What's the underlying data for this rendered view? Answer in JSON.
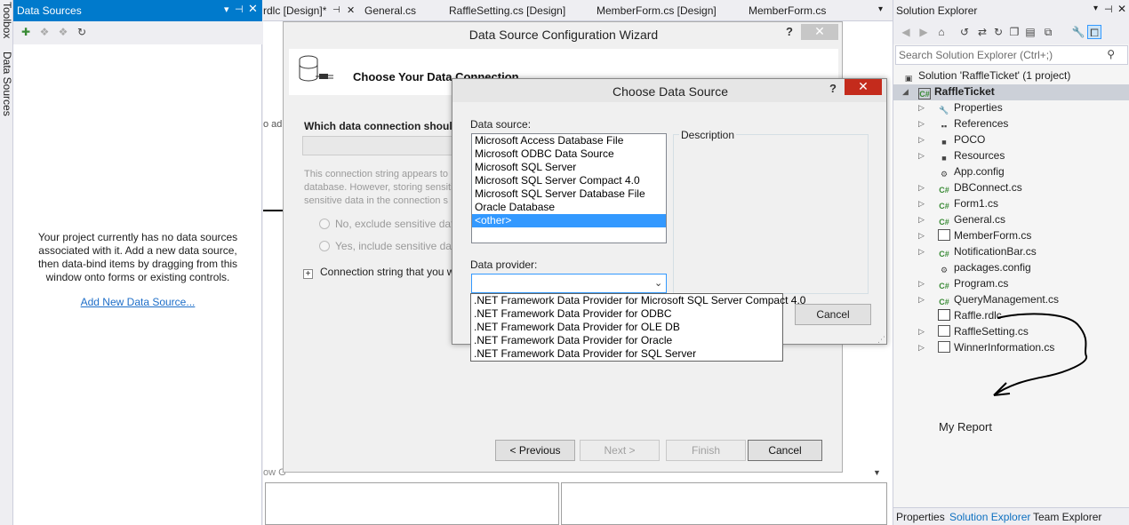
{
  "toolbox_strip": {
    "toolbox_label": "Toolbox",
    "data_sources_label": "Data Sources"
  },
  "data_sources": {
    "title": "Data Sources",
    "message": "Your project currently has no data sources associated with it. Add a new data source, then data-bind items by dragging from this window onto forms or existing controls.",
    "add_link": "Add New Data Source..."
  },
  "tabs": [
    "rdlc [Design]*",
    "General.cs",
    "RaffleSetting.cs [Design]",
    "MemberForm.cs [Design]",
    "MemberForm.cs"
  ],
  "editor": {
    "hint": "o ad",
    "group_label": "ow G"
  },
  "wizard": {
    "title": "Data Source Configuration Wizard",
    "help": "?",
    "heading": "Choose Your Data Connection",
    "question": "Which data connection should y",
    "info_lines": [
      "This connection string appears to",
      "database. However, storing sensiti",
      "sensitive data in the connection s"
    ],
    "radio_no": "No, exclude sensitive data",
    "radio_yes": "Yes, include sensitive da",
    "expand_label": "Connection string that you w",
    "buttons": {
      "previous": "< Previous",
      "next": "Next >",
      "finish": "Finish",
      "cancel": "Cancel"
    }
  },
  "choose_data_source": {
    "title": "Choose Data Source",
    "help": "?",
    "data_source_label": "Data source:",
    "data_sources": [
      "Microsoft Access Database File",
      "Microsoft ODBC Data Source",
      "Microsoft SQL Server",
      "Microsoft SQL Server Compact 4.0",
      "Microsoft SQL Server Database File",
      "Oracle Database",
      "<other>"
    ],
    "selected_index": 6,
    "description_label": "Description",
    "data_provider_label": "Data provider:",
    "data_provider_value": "",
    "cancel": "Cancel"
  },
  "provider_dropdown": [
    ".NET Framework Data Provider for Microsoft SQL Server Compact 4.0",
    ".NET Framework Data Provider for ODBC",
    ".NET Framework Data Provider for OLE DB",
    ".NET Framework Data Provider for Oracle",
    ".NET Framework Data Provider for SQL Server"
  ],
  "solution_explorer": {
    "title": "Solution Explorer",
    "search_placeholder": "Search Solution Explorer (Ctrl+;)",
    "solution": "Solution 'RaffleTicket' (1 project)",
    "project": "RaffleTicket",
    "items": [
      "Properties",
      "References",
      "POCO",
      "Resources",
      "App.config",
      "DBConnect.cs",
      "Form1.cs",
      "General.cs",
      "MemberForm.cs",
      "NotificationBar.cs",
      "packages.config",
      "Program.cs",
      "QueryManagement.cs",
      "Raffle.rdlc",
      "RaffleSetting.cs",
      "WinnerInformation.cs"
    ],
    "bottom_tabs": [
      "Properties",
      "Solution Explorer",
      "Team Explorer"
    ]
  },
  "annotation": "My Report",
  "colors": {
    "accent": "#007acc",
    "selection": "#3399ff",
    "close_red": "#c42b1c"
  }
}
